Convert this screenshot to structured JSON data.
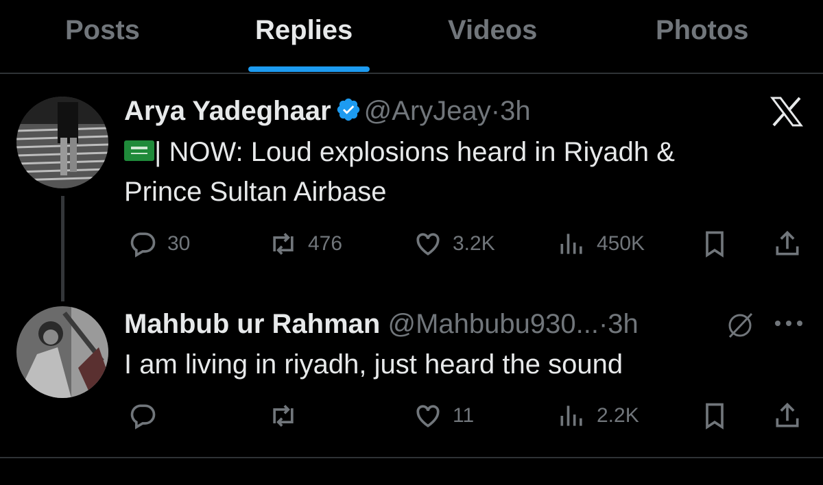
{
  "tabs": [
    {
      "label": "Posts",
      "active": false
    },
    {
      "label": "Replies",
      "active": true
    },
    {
      "label": "Videos",
      "active": false
    },
    {
      "label": "Photos",
      "active": false
    }
  ],
  "colors": {
    "background": "#000000",
    "text_primary": "#e7e9ea",
    "text_secondary": "#71767b",
    "accent": "#1d9bf0",
    "verified": "#1d9bf0",
    "divider": "#2f3336"
  },
  "tweets": [
    {
      "name": "Arya Yadeghaar",
      "verified": true,
      "handle": "@AryJeay",
      "separator": "·",
      "time": "3h",
      "flag_icon": "saudi-flag-emoji",
      "text_line1": "| NOW: Loud explosions heard in Riyadh &",
      "text_line2": "Prince Sultan Airbase",
      "corner_icon": "x-logo-icon",
      "stats": {
        "replies": "30",
        "reposts": "476",
        "likes": "3.2K",
        "views": "450K"
      }
    },
    {
      "name": "Mahbub ur Rahman",
      "verified": false,
      "handle": "@Mahbubu930...",
      "separator": "·",
      "time": "3h",
      "text_line1": "I am living in riyadh, just heard the sound",
      "corner_icon": "more-icon",
      "stats": {
        "replies": "",
        "reposts": "",
        "likes": "11",
        "views": "2.2K"
      }
    }
  ]
}
